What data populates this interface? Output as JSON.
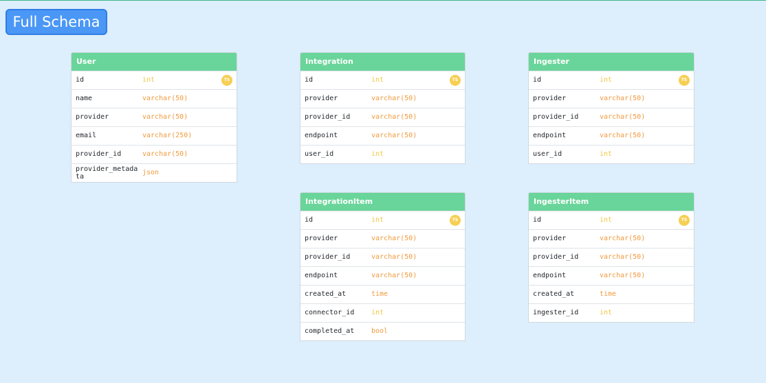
{
  "title": "Full Schema",
  "type_colors": {
    "int": "#f2c744",
    "varchar(50)": "#f09a3e",
    "varchar(250)": "#f09a3e",
    "json": "#f09a3e",
    "time": "#f09a3e",
    "bool": "#f09a3e"
  },
  "tables": [
    {
      "name": "User",
      "columns": [
        {
          "name": "id",
          "type": "int",
          "badge": "TS"
        },
        {
          "name": "name",
          "type": "varchar(50)"
        },
        {
          "name": "provider",
          "type": "varchar(50)"
        },
        {
          "name": "email",
          "type": "varchar(250)"
        },
        {
          "name": "provider_id",
          "type": "varchar(50)"
        },
        {
          "name": "provider_metadata",
          "type": "json"
        }
      ]
    },
    {
      "name": "Integration",
      "columns": [
        {
          "name": "id",
          "type": "int",
          "badge": "TS"
        },
        {
          "name": "provider",
          "type": "varchar(50)"
        },
        {
          "name": "provider_id",
          "type": "varchar(50)"
        },
        {
          "name": "endpoint",
          "type": "varchar(50)"
        },
        {
          "name": "user_id",
          "type": "int"
        }
      ]
    },
    {
      "name": "Ingester",
      "columns": [
        {
          "name": "id",
          "type": "int",
          "badge": "TS"
        },
        {
          "name": "provider",
          "type": "varchar(50)"
        },
        {
          "name": "provider_id",
          "type": "varchar(50)"
        },
        {
          "name": "endpoint",
          "type": "varchar(50)"
        },
        {
          "name": "user_id",
          "type": "int"
        }
      ]
    },
    {
      "name": "IntegrationItem",
      "columns": [
        {
          "name": "id",
          "type": "int",
          "badge": "TS"
        },
        {
          "name": "provider",
          "type": "varchar(50)"
        },
        {
          "name": "provider_id",
          "type": "varchar(50)"
        },
        {
          "name": "endpoint",
          "type": "varchar(50)"
        },
        {
          "name": "created_at",
          "type": "time"
        },
        {
          "name": "connector_id",
          "type": "int"
        },
        {
          "name": "completed_at",
          "type": "bool"
        }
      ]
    },
    {
      "name": "IngesterItem",
      "columns": [
        {
          "name": "id",
          "type": "int",
          "badge": "TS"
        },
        {
          "name": "provider",
          "type": "varchar(50)"
        },
        {
          "name": "provider_id",
          "type": "varchar(50)"
        },
        {
          "name": "endpoint",
          "type": "varchar(50)"
        },
        {
          "name": "created_at",
          "type": "time"
        },
        {
          "name": "ingester_id",
          "type": "int"
        }
      ]
    }
  ]
}
